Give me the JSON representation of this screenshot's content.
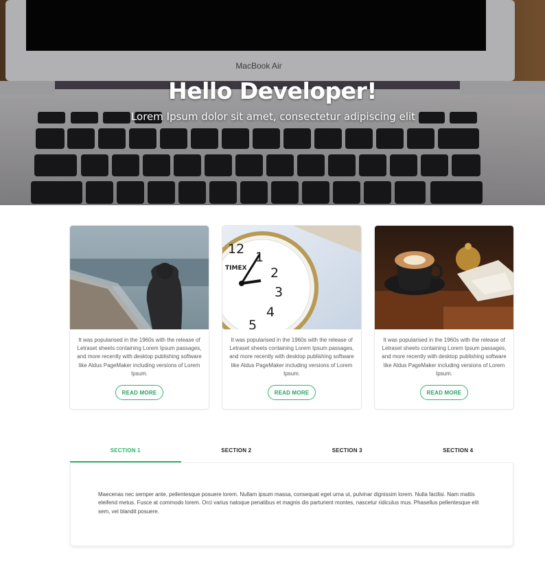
{
  "hero": {
    "title": "Hello Developer!",
    "subtitle": "Lorem Ipsum dolor sit amet, consectetur adipiscing elit",
    "device_label": "MacBook Air"
  },
  "cards": [
    {
      "image_icon": "person-on-beach-image",
      "text": "It was popularised in the 1960s with the release of Letraset sheets containing Lorem Ipsum passages, and more recently with desktop publishing software like Aldus PageMaker including versions of Lorem Ipsum.",
      "button_label": "READ MORE"
    },
    {
      "image_icon": "alarm-clock-image",
      "text": "It was popularised in the 1960s with the release of Letraset sheets containing Lorem Ipsum passages, and more recently with desktop publishing software like Aldus PageMaker including versions of Lorem Ipsum.",
      "button_label": "READ MORE"
    },
    {
      "image_icon": "coffee-cup-image",
      "text": "It was popularised in the 1960s with the release of Letraset sheets containing Lorem Ipsum passages, and more recently with desktop publishing software like Aldus PageMaker including versions of Lorem Ipsum.",
      "button_label": "READ MORE"
    }
  ],
  "tabs": {
    "items": [
      {
        "label": "SECTION 1",
        "active": true
      },
      {
        "label": "SECTION 2",
        "active": false
      },
      {
        "label": "SECTION 3",
        "active": false
      },
      {
        "label": "SECTION 4",
        "active": false
      }
    ],
    "content": "Maecenas nec semper ante, pellentesque posuere lorem. Nullam ipsum massa, consequat eget urna ut, pulvinar dignissim lorem. Nulla facilisi. Nam mattis eleifend metus. Fusce at commodo lorem. Orci varius natoque penatibus et magnis dis parturient montes, nascetur ridiculus mus. Phasellus pellentesque elit sem, vel blandit posuere."
  },
  "colors": {
    "accent": "#2db36a",
    "text": "#444444",
    "hero_text": "#ffffff"
  }
}
